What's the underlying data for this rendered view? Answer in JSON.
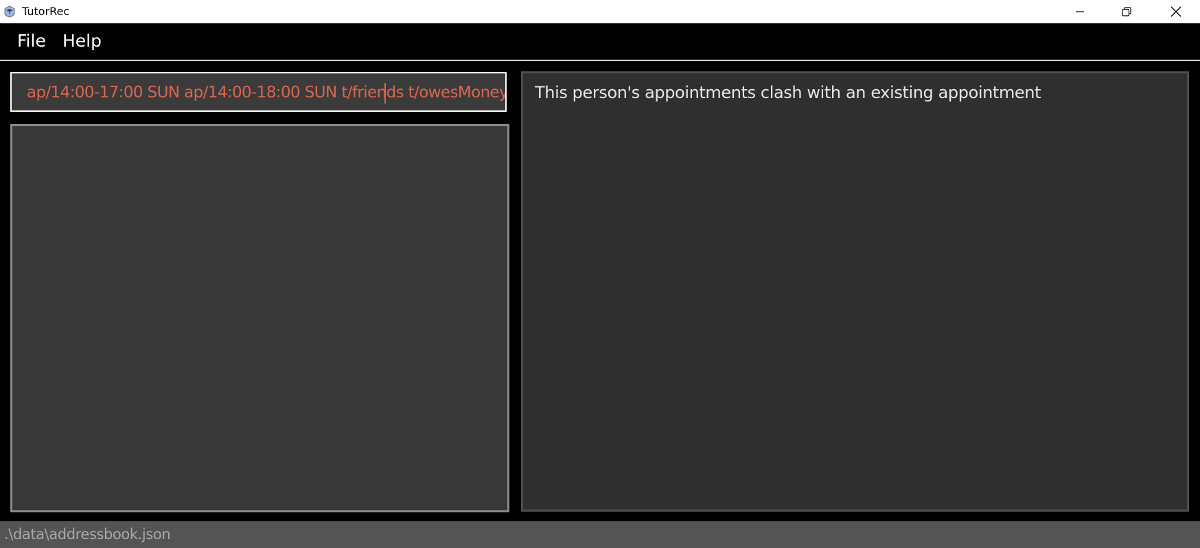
{
  "window": {
    "title": "TutorRec",
    "icon": "app-logo-icon",
    "controls": [
      "minimize-icon",
      "restore-icon",
      "close-icon"
    ]
  },
  "menu": {
    "items": [
      {
        "label": "File"
      },
      {
        "label": "Help"
      }
    ]
  },
  "command_box": {
    "value": "ap/14:00-17:00 SUN ap/14:00-18:00 SUN t/friends t/owesMoney",
    "text_color": "#d9664f"
  },
  "result_display": {
    "message": "This person's appointments clash with an existing appointment"
  },
  "status_bar": {
    "save_location": ".\\data\\addressbook.json"
  },
  "colors": {
    "background": "#000000",
    "panel": "#383838",
    "result_panel": "#2f2f2f",
    "status_bar": "#545454",
    "error_text": "#d9664f"
  }
}
